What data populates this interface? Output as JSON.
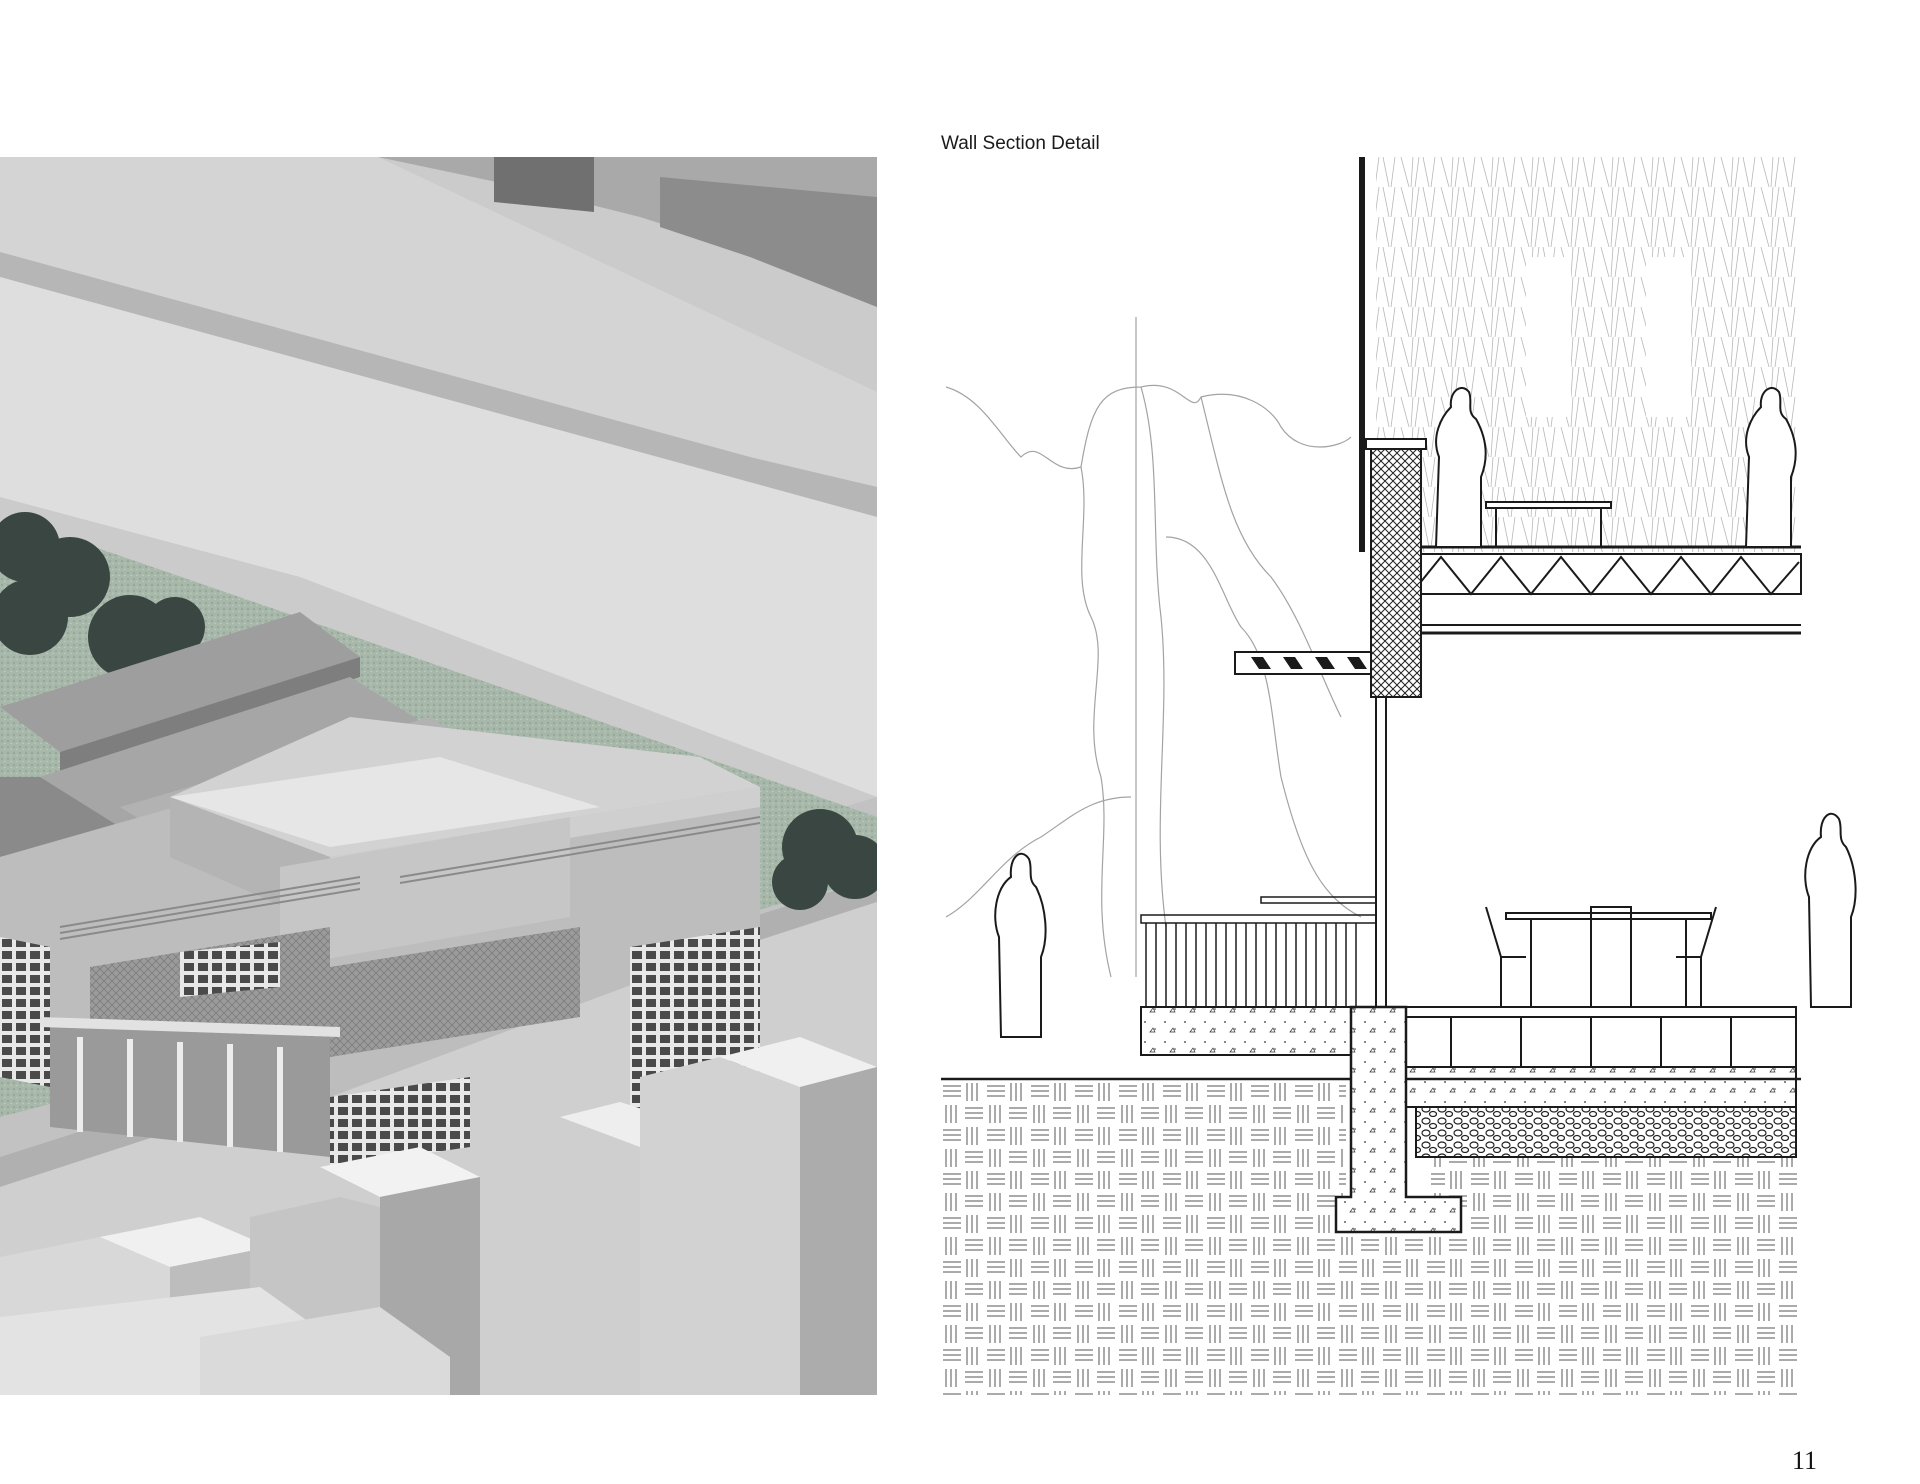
{
  "page": {
    "title": "Wall Section Detail",
    "page_number": "11"
  },
  "left_panel": {
    "image": "axonometric-site-render",
    "colors": {
      "ground": "#c9c9c9",
      "grass": "#9fb3a3",
      "trees": "#3b4540",
      "building": "#bdbdbd"
    }
  },
  "right_panel": {
    "image": "wall-section-drawing",
    "colors": {
      "line": "#1a1a1a",
      "light_line": "#9a9a9a"
    }
  }
}
